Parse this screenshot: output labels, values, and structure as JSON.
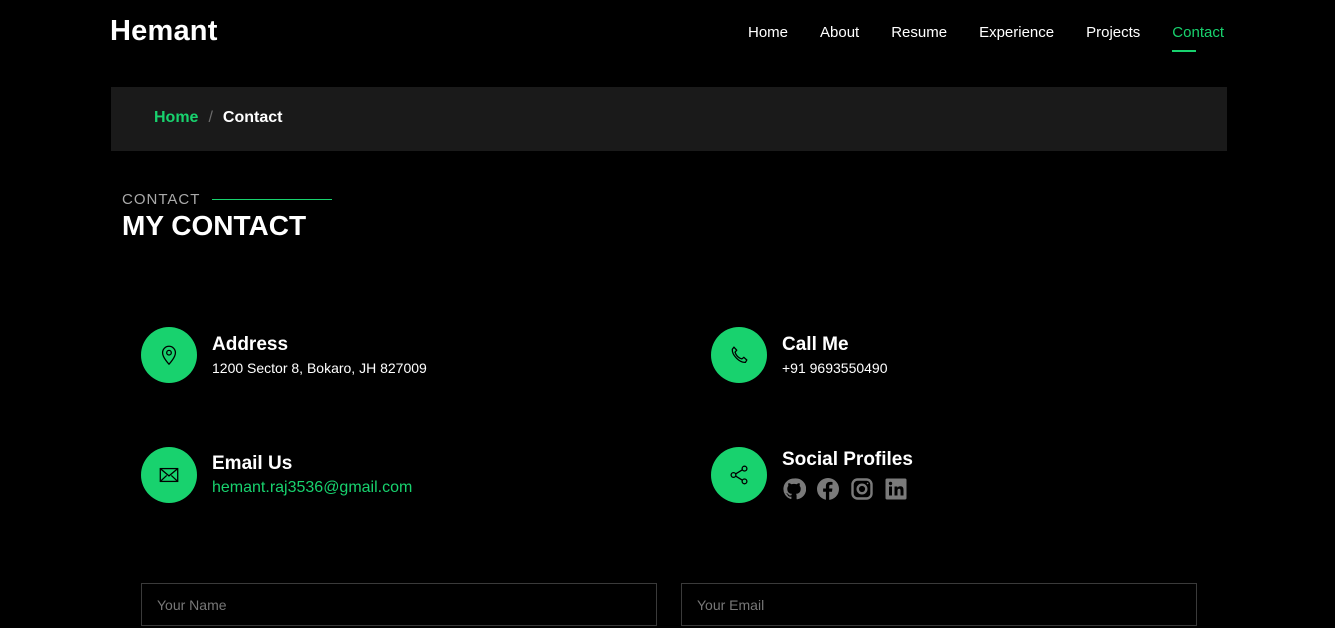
{
  "brand": {
    "name": "Hemant"
  },
  "nav": {
    "items": [
      {
        "label": "Home"
      },
      {
        "label": "About"
      },
      {
        "label": "Resume"
      },
      {
        "label": "Experience"
      },
      {
        "label": "Projects"
      },
      {
        "label": "Contact",
        "active": true
      }
    ]
  },
  "breadcrumb": {
    "home": "Home",
    "separator": "/",
    "current": "Contact"
  },
  "section": {
    "subtitle": "CONTACT",
    "title": "MY CONTACT"
  },
  "contact": {
    "address": {
      "title": "Address",
      "value": "1200 Sector 8, Bokaro, JH 827009",
      "icon": "map-pin-icon"
    },
    "call": {
      "title": "Call Me",
      "value": "+91 9693550490",
      "icon": "phone-icon"
    },
    "email": {
      "title": "Email Us",
      "value": "hemant.raj3536@gmail.com",
      "icon": "envelope-icon"
    },
    "social": {
      "title": "Social Profiles",
      "icon": "share-icon",
      "links": [
        "github-icon",
        "facebook-icon",
        "instagram-icon",
        "linkedin-icon"
      ]
    }
  },
  "form": {
    "name_placeholder": "Your Name",
    "email_placeholder": "Your Email"
  },
  "colors": {
    "accent": "#18d26e",
    "background": "#000000",
    "panel": "#1a1a1a"
  }
}
